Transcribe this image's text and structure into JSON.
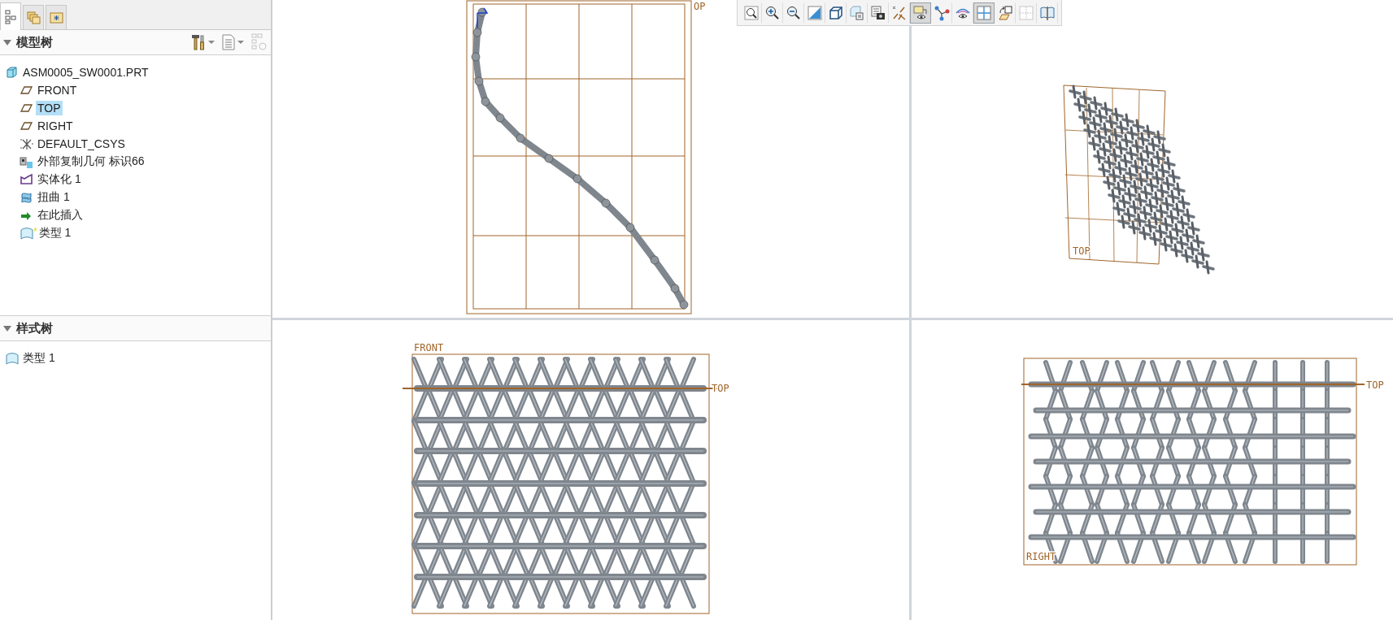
{
  "model_panel": {
    "tabs": [
      {
        "selected": true
      },
      {
        "selected": false
      },
      {
        "selected": false
      }
    ],
    "model_tree": {
      "title": "模型树",
      "expanded": true,
      "items": [
        {
          "kind": "part",
          "label": "ASM0005_SW0001.PRT",
          "selected": false,
          "children": [
            {
              "kind": "datum-plane",
              "label": "FRONT",
              "selected": false
            },
            {
              "kind": "datum-plane",
              "label": "TOP",
              "selected": true
            },
            {
              "kind": "datum-plane",
              "label": "RIGHT",
              "selected": false
            },
            {
              "kind": "csys",
              "label": "DEFAULT_CSYS",
              "selected": false
            },
            {
              "kind": "copy-geometry",
              "label": "外部复制几何 标识66",
              "selected": false
            },
            {
              "kind": "solidify",
              "label": "实体化 1",
              "selected": false
            },
            {
              "kind": "warp",
              "label": "扭曲 1",
              "selected": false
            },
            {
              "kind": "insert",
              "label": "在此插入",
              "selected": false
            },
            {
              "kind": "style",
              "marker": "*",
              "label": "类型 1",
              "selected": false
            }
          ]
        }
      ]
    },
    "style_tree": {
      "title": "样式树",
      "expanded": true,
      "items": [
        {
          "kind": "style",
          "label": "类型 1",
          "selected": false
        }
      ]
    }
  },
  "view_toolbar": [
    {
      "on": false
    },
    {
      "on": false
    },
    {
      "on": false
    },
    {
      "on": false
    },
    {
      "on": false
    },
    {
      "on": false
    },
    {
      "on": false
    },
    {
      "on": false
    },
    {
      "on": true
    },
    {
      "on": false
    },
    {
      "on": false
    },
    {
      "on": true
    },
    {
      "on": false
    },
    {
      "on": false
    },
    {
      "on": false
    }
  ],
  "viewports": [
    {
      "kind": "side",
      "labels": [
        "OP"
      ]
    },
    {
      "kind": "iso",
      "labels": [
        "TOP"
      ]
    },
    {
      "kind": "front",
      "labels": [
        "FRONT",
        "TOP"
      ]
    },
    {
      "kind": "right",
      "labels": [
        "TOP",
        "RIGHT"
      ]
    }
  ]
}
